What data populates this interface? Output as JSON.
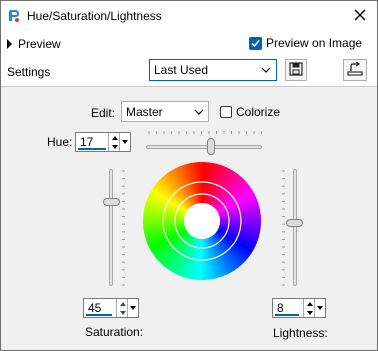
{
  "window": {
    "title": "Hue/Saturation/Lightness",
    "close_icon": "close-icon",
    "app_icon": "paint-icon"
  },
  "toolbar": {
    "preview_label": "Preview",
    "preview_on_image_label": "Preview on Image",
    "preview_on_image_checked": true
  },
  "settings": {
    "label": "Settings",
    "preset_value": "Last Used",
    "save_icon": "floppy-disk-icon",
    "reset_icon": "reset-defaults-icon"
  },
  "edit": {
    "label": "Edit:",
    "value": "Master",
    "colorize_label": "Colorize",
    "colorize_checked": false
  },
  "hue": {
    "label": "Hue:",
    "value": "17",
    "slider_fraction": 0.56
  },
  "saturation": {
    "label": "Saturation:",
    "value": "45",
    "slider_fraction": 0.28
  },
  "lightness": {
    "label": "Lightness:",
    "value": "8",
    "slider_fraction": 0.46
  },
  "colors": {
    "accent": "#0063b1",
    "dialog_bg": "#f0f0f0",
    "header_bg": "#ffffff"
  }
}
